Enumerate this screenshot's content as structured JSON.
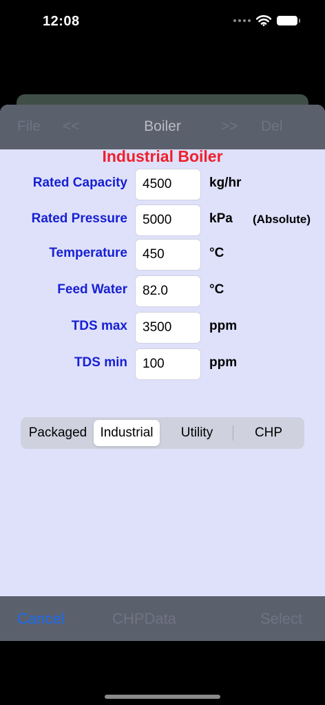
{
  "status": {
    "time": "12:08"
  },
  "nav": {
    "file": "File",
    "prev": "<<",
    "title": "Boiler",
    "next": ">>",
    "delete": "Del"
  },
  "heading": "Industrial Boiler",
  "fields": [
    {
      "label": "Rated Capacity",
      "value": "4500",
      "unit": "kg/hr"
    },
    {
      "label": "Rated Pressure",
      "value": "5000",
      "unit": "kPa",
      "note": "(Absolute)"
    },
    {
      "label": "Temperature",
      "value": "450",
      "unit": "°C"
    },
    {
      "label": "Feed Water",
      "value": "82.0",
      "unit": "°C"
    },
    {
      "label": "TDS max",
      "value": "3500",
      "unit": "ppm"
    },
    {
      "label": "TDS min",
      "value": "100",
      "unit": "ppm"
    }
  ],
  "segments": {
    "items": [
      "Packaged",
      "Industrial",
      "Utility",
      "CHP"
    ],
    "selected": "Industrial"
  },
  "toolbar": {
    "cancel": "Cancel",
    "chpdata": "CHPData",
    "select": "Select"
  },
  "colors": {
    "label_blue": "#1720d2",
    "heading_red": "#f01f2b",
    "accent_blue": "#1a6bf0",
    "sheet_bg": "#dfe1fb",
    "bar_bg": "#5b606d"
  },
  "icons": {
    "wifi": "wifi-icon",
    "battery": "battery-icon",
    "signal": "cellular-signal-icon"
  }
}
